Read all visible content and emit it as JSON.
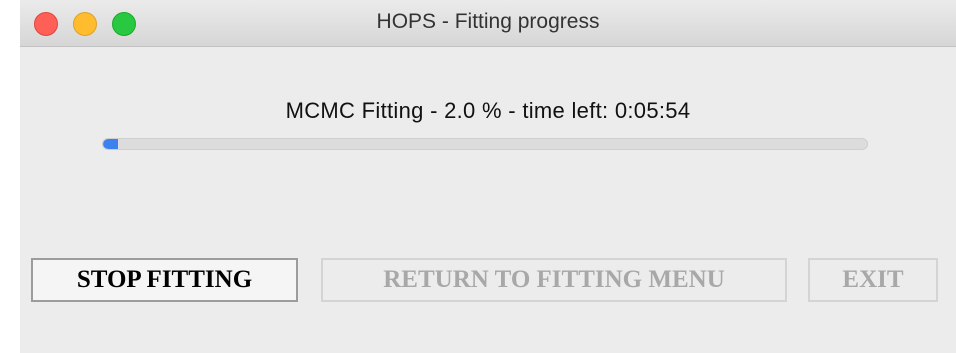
{
  "window": {
    "title": "HOPS - Fitting progress"
  },
  "progress": {
    "status_text": "MCMC Fitting - 2.0 % - time left: 0:05:54",
    "percent": 2.0,
    "color": "#3b82f0"
  },
  "buttons": {
    "stop_label": "STOP FITTING",
    "return_label": "RETURN TO FITTING MENU",
    "exit_label": "EXIT"
  }
}
